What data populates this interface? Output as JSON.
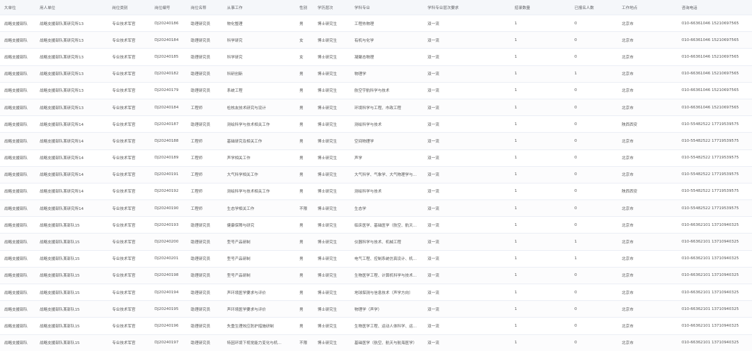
{
  "table": {
    "headers": [
      "大单位",
      "用人单位",
      "岗位类别",
      "岗位编号",
      "岗位名称",
      "从事工作",
      "性别",
      "学历层次",
      "学科专业",
      "学科专业层次要求",
      "招录数量",
      "已报名人数",
      "工作地点",
      "咨询电话"
    ],
    "rows": [
      [
        "战略支援部队",
        "战略支援部队某研究所13",
        "专业技术军官",
        "DJ20240186",
        "助理研究员",
        "物化整理",
        "男",
        "博士研究生",
        "工程热物理",
        "双一流",
        "1",
        "0",
        "北京市",
        "010-66361046 15210697565"
      ],
      [
        "战略支援部队",
        "战略支援部队某研究所13",
        "专业技术军官",
        "DJ20240184",
        "助理研究员",
        "科学研究",
        "女",
        "博士研究生",
        "有机与化学",
        "双一流",
        "1",
        "0",
        "北京市",
        "010-66361046 15210697565"
      ],
      [
        "战略支援部队",
        "战略支援部队某研究所13",
        "专业技术军官",
        "DJ20240185",
        "助理研究员",
        "科学研究",
        "女",
        "博士研究生",
        "凝聚态物理",
        "双一流",
        "1",
        "0",
        "北京市",
        "010-66361046 15210697565"
      ],
      [
        "战略支援部队",
        "战略支援部队某研究所13",
        "专业技术军官",
        "DJ20240182",
        "助理研究员",
        "科研创新",
        "男",
        "博士研究生",
        "物理学",
        "双一流",
        "1",
        "1",
        "北京市",
        "010-66361046 15210697565"
      ],
      [
        "战略支援部队",
        "战略支援部队某研究所13",
        "专业技术军官",
        "DJ20240179",
        "助理研究员",
        "系统工程",
        "男",
        "博士研究生",
        "航空宇航科学与技术",
        "双一流",
        "1",
        "0",
        "北京市",
        "010-66361046 15210697565"
      ],
      [
        "战略支援部队",
        "战略支援部队某研究所13",
        "专业技术军官",
        "DJ20240184",
        "工程师",
        "检核友技术研究与设计",
        "男",
        "博士研究生",
        "环境科学与工程、市政工程",
        "双一流",
        "1",
        "0",
        "北京市",
        "010-66361046 15210697565"
      ],
      [
        "战略支援部队",
        "战略支援部队某研究所14",
        "专业技术军官",
        "DJ20240187",
        "助理研究员",
        "测绘科学与技术相关工作",
        "男",
        "博士研究生",
        "测绘科学与技术",
        "双一流",
        "1",
        "0",
        "陕西西安",
        "010-55482522 17719539575"
      ],
      [
        "战略支援部队",
        "战略支援部队某研究所14",
        "专业技术军官",
        "DJ20240188",
        "工程师",
        "基础研究及相关工作",
        "男",
        "博士研究生",
        "空间物理学",
        "双一流",
        "1",
        "0",
        "北京市",
        "010-55482522 17719539575"
      ],
      [
        "战略支援部队",
        "战略支援部队某研究所14",
        "专业技术军官",
        "DJ20240189",
        "工程师",
        "声学相关工作",
        "男",
        "博士研究生",
        "声学",
        "双一流",
        "1",
        "0",
        "北京市",
        "010-55482522 17719539575"
      ],
      [
        "战略支援部队",
        "战略支援部队某研究所14",
        "专业技术军官",
        "DJ20240191",
        "工程师",
        "大气科学相关工作",
        "男",
        "博士研究生",
        "大气科学、气象学、大气物理学与...",
        "双一流",
        "1",
        "0",
        "北京市",
        "010-55482522 17719539575"
      ],
      [
        "战略支援部队",
        "战略支援部队某研究所14",
        "专业技术军官",
        "DJ20240192",
        "工程师",
        "测绘科学与技术相关工作",
        "男",
        "博士研究生",
        "测绘科学与技术",
        "双一流",
        "1",
        "0",
        "陕西西安",
        "010-55482522 17719539575"
      ],
      [
        "战略支援部队",
        "战略支援部队某研究所14",
        "专业技术军官",
        "DJ20240190",
        "工程师",
        "生态学相关工作",
        "不限",
        "博士研究生",
        "生态学",
        "双一流",
        "1",
        "0",
        "北京市",
        "010-55482522 17719539575"
      ],
      [
        "战略支援部队",
        "战略支援部队某部队15",
        "专业技术军官",
        "DJ20240193",
        "助理研究员",
        "健康保障与研究",
        "男",
        "博士研究生",
        "临床医学、基础医学（航空、航天...",
        "双一流",
        "1",
        "0",
        "北京市",
        "010-66362101 13710940325"
      ],
      [
        "战略支援部队",
        "战略支援部队某部队15",
        "专业技术军官",
        "DJ20240200",
        "助理研究员",
        "型号产品研制",
        "男",
        "博士研究生",
        "仪器科学与技术、机械工程",
        "双一流",
        "1",
        "1",
        "北京市",
        "010-66362101 13710940325"
      ],
      [
        "战略支援部队",
        "战略支援部队某部队15",
        "专业技术军官",
        "DJ20240201",
        "助理研究员",
        "型号产品研制",
        "男",
        "博士研究生",
        "电气工程、控制系统仿真设计、机...",
        "双一流",
        "1",
        "1",
        "北京市",
        "010-66362101 13710940325"
      ],
      [
        "战略支援部队",
        "战略支援部队某部队15",
        "专业技术军官",
        "DJ20240198",
        "助理研究员",
        "型号产品研制",
        "男",
        "博士研究生",
        "生物医学工程、计算机科学与技术...",
        "双一流",
        "1",
        "0",
        "北京市",
        "010-66362101 13710940325"
      ],
      [
        "战略支援部队",
        "战略支援部队某部队15",
        "专业技术军官",
        "DJ20240194",
        "助理研究员",
        "声环境医学要求与评价",
        "男",
        "博士研究生",
        "地球探测与信息技术（声学方向）",
        "双一流",
        "1",
        "0",
        "北京市",
        "010-66362101 13710940325"
      ],
      [
        "战略支援部队",
        "战略支援部队某部队15",
        "专业技术军官",
        "DJ20240195",
        "助理研究员",
        "声环境医学要求与评价",
        "男",
        "博士研究生",
        "物理学（声学）",
        "双一流",
        "1",
        "0",
        "北京市",
        "010-66362101 13710940325"
      ],
      [
        "战略支援部队",
        "战略支援部队某部队15",
        "专业技术军官",
        "DJ20240196",
        "助理研究员",
        "失重生理效应防护措施研制",
        "男",
        "博士研究生",
        "生物医学工程、运动人体科学、运...",
        "双一流",
        "1",
        "0",
        "北京市",
        "010-66362101 13710940325"
      ],
      [
        "战略支援部队",
        "战略支援部队某部队15",
        "专业技术军官",
        "DJ20240197",
        "助理研究员",
        "特因环境下视觉能力变化与机...",
        "不限",
        "博士研究生",
        "基础医学（航空、航天与航海医学）",
        "双一流",
        "1",
        "0",
        "北京市",
        "010-66362101 13710940325"
      ]
    ]
  }
}
